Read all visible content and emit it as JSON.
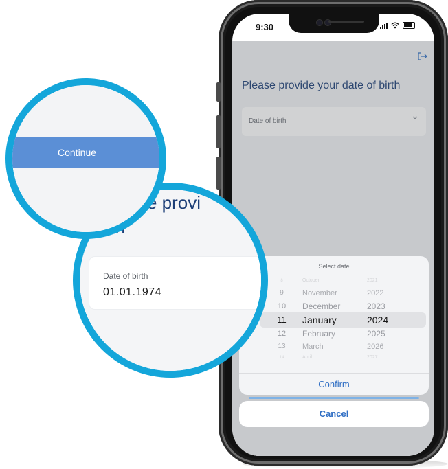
{
  "status_bar": {
    "time": "9:30"
  },
  "app": {
    "title": "Please provide your date of birth",
    "dob_field_label": "Date of birth"
  },
  "picker": {
    "title": "Select date",
    "rows": [
      {
        "day": "8",
        "month": "October",
        "year": "2021"
      },
      {
        "day": "9",
        "month": "November",
        "year": "2022"
      },
      {
        "day": "10",
        "month": "December",
        "year": "2023"
      },
      {
        "day": "11",
        "month": "January",
        "year": "2024"
      },
      {
        "day": "12",
        "month": "February",
        "year": "2025"
      },
      {
        "day": "13",
        "month": "March",
        "year": "2026"
      },
      {
        "day": "14",
        "month": "April",
        "year": "2027"
      }
    ],
    "confirm_label": "Confirm",
    "cancel_label": "Cancel"
  },
  "zoom_continue": {
    "button_label": "Continue"
  },
  "zoom_field": {
    "heading_line1": "e provi",
    "heading_line2": "irth",
    "field_label": "Date of birth",
    "field_value": "01.01.1974"
  },
  "colors": {
    "accent_blue": "#2f6ec4",
    "title_navy": "#1d3f78",
    "magnifier_ring": "#14a6da",
    "continue_button": "#5b8fd6"
  }
}
